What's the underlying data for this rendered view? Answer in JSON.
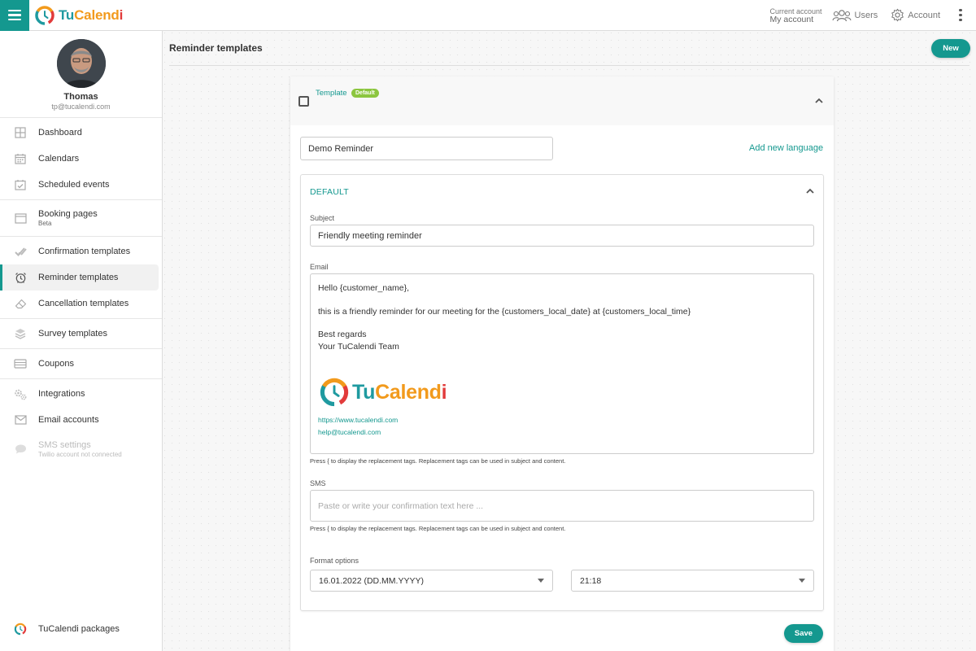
{
  "app": {
    "brand_parts": [
      "Tu",
      "Calend",
      "i"
    ],
    "accent_color": "#14988f"
  },
  "topbar": {
    "current_account_label": "Current account",
    "current_account_value": "My account",
    "users_label": "Users",
    "account_label": "Account"
  },
  "sidebar": {
    "user_name": "Thomas",
    "user_email": "tp@tucalendi.com",
    "items": [
      {
        "label": "Dashboard",
        "icon": "dashboard-icon"
      },
      {
        "label": "Calendars",
        "icon": "calendar-icon"
      },
      {
        "label": "Scheduled events",
        "icon": "calendar-check-icon"
      },
      {
        "label": "Booking pages",
        "sub": "Beta",
        "icon": "browser-window-icon"
      },
      {
        "label": "Confirmation templates",
        "icon": "double-check-icon"
      },
      {
        "label": "Reminder templates",
        "icon": "alarm-clock-icon",
        "active": true
      },
      {
        "label": "Cancellation templates",
        "icon": "eraser-icon"
      },
      {
        "label": "Survey templates",
        "icon": "layers-icon"
      },
      {
        "label": "Coupons",
        "icon": "ticket-icon"
      },
      {
        "label": "Integrations",
        "icon": "gears-icon"
      },
      {
        "label": "Email accounts",
        "icon": "envelope-icon"
      },
      {
        "label": "SMS settings",
        "sub": "Twilio account not connected",
        "icon": "chat-bubble-icon",
        "disabled": true
      }
    ],
    "packages_label": "TuCalendi packages"
  },
  "main": {
    "page_title": "Reminder templates",
    "new_button": "New",
    "template": {
      "label": "Template",
      "badge": "Default",
      "name_value": "Demo Reminder",
      "add_language": "Add new language",
      "language": {
        "title": "DEFAULT",
        "subject_label": "Subject",
        "subject_value": "Friendly meeting reminder",
        "email_label": "Email",
        "email_body": {
          "greeting": "Hello {customer_name},",
          "line": "this is a friendly reminder for our meeting for the {customers_local_date} at {customers_local_time}",
          "closing1": "Best regards",
          "closing2": "Your TuCalendi Team",
          "logo_parts": [
            "Tu",
            "Calend",
            "i"
          ],
          "website": "https://www.tucalendi.com",
          "email": "help@tucalendi.com"
        },
        "hint": "Press { to display the replacement tags. Replacement tags can be used in subject and content.",
        "sms_label": "SMS",
        "sms_placeholder": "Paste or write your confirmation text here ...",
        "format_label": "Format options",
        "date_format": "16.01.2022 (DD.MM.YYYY)",
        "time_format": "21:18"
      }
    },
    "save_button": "Save"
  }
}
